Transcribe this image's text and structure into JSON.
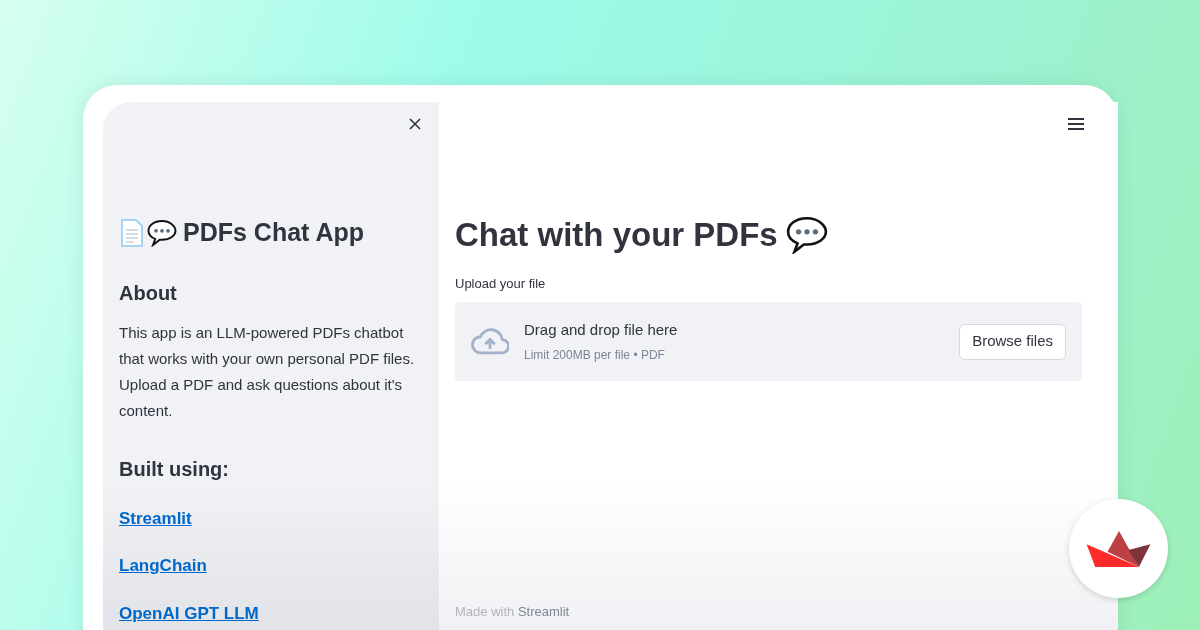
{
  "sidebar": {
    "title": "PDFs Chat App",
    "about_heading": "About",
    "about_text": "This app is an LLM-powered PDFs chatbot that works with your own personal PDF files. Upload a PDF and ask questions about it's content.",
    "built_heading": "Built using:",
    "links": [
      "Streamlit",
      "LangChain",
      "OpenAI GPT LLM"
    ]
  },
  "main": {
    "title": "Chat with your PDFs",
    "uploader": {
      "label": "Upload your file",
      "drop_text": "Drag and drop file here",
      "limit_text": "Limit 200MB per file • PDF",
      "button": "Browse files"
    },
    "footer": {
      "text": "Made with",
      "link": "Streamlit"
    }
  }
}
